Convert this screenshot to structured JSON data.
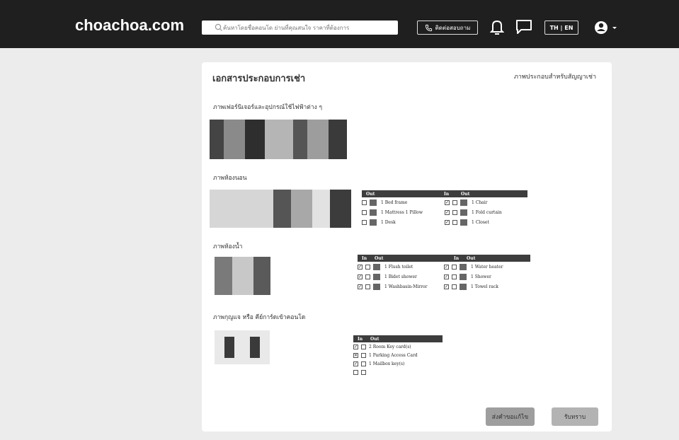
{
  "header": {
    "logo": "choachoa.com",
    "search_placeholder": "ค้นหาโดยชื่อคอนโด ย่านที่คุณสนใจ ราคาที่ต้องการ",
    "contact_label": "ติดต่อสอบถาม",
    "lang_label": "TH | EN"
  },
  "card": {
    "title": "เอกสารประกอบการเช่า",
    "subtitle": "ภาพประกอบสำหรับสัญญาเช่า",
    "sections": [
      "ภาพเฟอร์นิเจอร์และอุปกรณ์ใช้ไฟฟ้าต่าง ๆ",
      "ภาพห้องนอน",
      "ภาพห้องน้ำ",
      "ภาพกุญแจ หรือ คีย์การ์ดเข้าคอนโด"
    ],
    "bedroom_checklist": {
      "headers": [
        "Out",
        "In",
        "Out"
      ],
      "left": [
        "1 Bed frame",
        "1 Mattress  1 Pillow",
        "1 Desk"
      ],
      "right": [
        "1 Chair",
        "1 Fold curtain",
        "1 Closet"
      ]
    },
    "bathroom_checklist": {
      "headers": [
        "In",
        "Out",
        "In",
        "Out"
      ],
      "left": [
        "1 Flush toilet",
        "1 Bidet shower",
        "1 Washbasin-Mirror"
      ],
      "right": [
        "1 Water heater",
        "1 Shower",
        "1 Towel rack"
      ]
    },
    "key_checklist": {
      "headers": [
        "In",
        "Out"
      ],
      "items": [
        "2 Room  Key card(s)",
        "1 Parking Access Card",
        "1 Mailbox key(s)",
        ""
      ]
    },
    "buttons": {
      "request_fix": "ส่งคำขอแก้ไข",
      "acknowledge": "รับทราบ"
    }
  }
}
